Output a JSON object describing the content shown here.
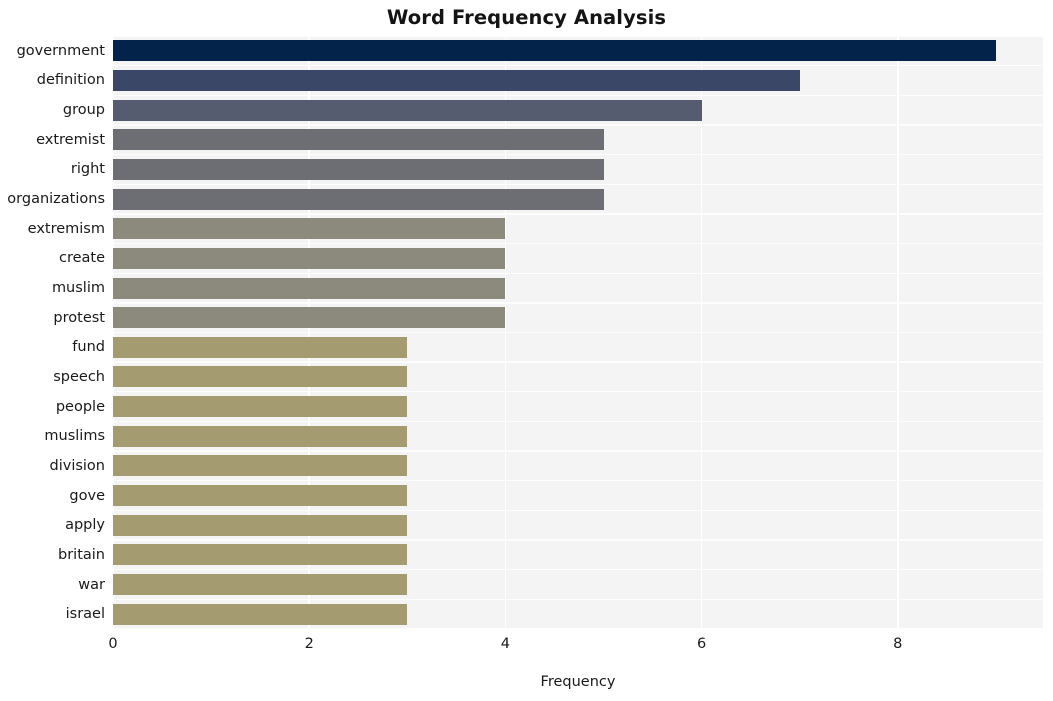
{
  "chart_data": {
    "type": "bar",
    "orientation": "horizontal",
    "title": "Word Frequency Analysis",
    "xlabel": "Frequency",
    "ylabel": "",
    "categories": [
      "government",
      "definition",
      "group",
      "extremist",
      "right",
      "organizations",
      "extremism",
      "create",
      "muslim",
      "protest",
      "fund",
      "speech",
      "people",
      "muslims",
      "division",
      "gove",
      "apply",
      "britain",
      "war",
      "israel"
    ],
    "values": [
      9,
      7,
      6,
      5,
      5,
      5,
      4,
      4,
      4,
      4,
      3,
      3,
      3,
      3,
      3,
      3,
      3,
      3,
      3,
      3
    ],
    "bar_colors": [
      "#04234a",
      "#3b4767",
      "#565c70",
      "#6d6e73",
      "#6d6e73",
      "#6d6e73",
      "#8b8a7d",
      "#8b8a7d",
      "#8b8a7d",
      "#8b8a7d",
      "#a49b70",
      "#a49b70",
      "#a49b70",
      "#a49b70",
      "#a49b70",
      "#a49b70",
      "#a49b70",
      "#a49b70",
      "#a49b70",
      "#a49b70"
    ],
    "xlim": [
      0,
      9.48
    ],
    "xticks": [
      0,
      2,
      4,
      6,
      8
    ],
    "xtick_labels": [
      "0",
      "2",
      "4",
      "6",
      "8"
    ],
    "grid": true,
    "grid_color": "#ffffff",
    "plot_background": "#f4f4f4",
    "figure_background": "#ffffff",
    "legend": null
  }
}
